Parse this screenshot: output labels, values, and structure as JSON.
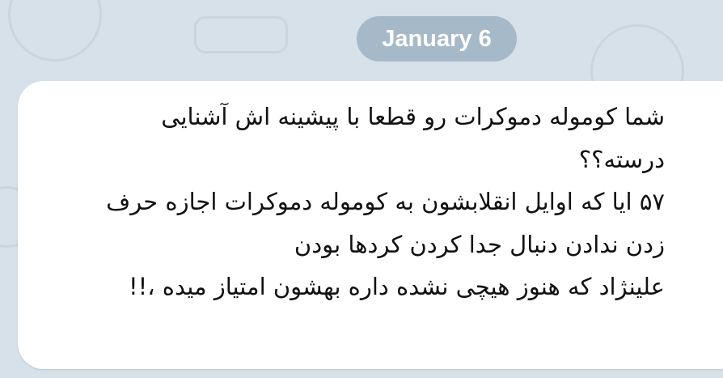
{
  "date_separator": "January 6",
  "message": {
    "lines": [
      "شما کوموله دموکرات رو قطعا با پیشینه اش آشنایی",
      "درسته؟؟",
      "۵۷ ایا که اوایل انقلابشون به کوموله دموکرات اجازه حرف",
      "زدن ندادن دنبال جدا کردن کردها بودن",
      "علینژاد که هنوز هیچی نشده داره بهشون امتیاز میده ،!!"
    ]
  },
  "colors": {
    "background": "#d7e1ea",
    "date_pill": "#a6b9c9",
    "bubble": "#ffffff"
  }
}
